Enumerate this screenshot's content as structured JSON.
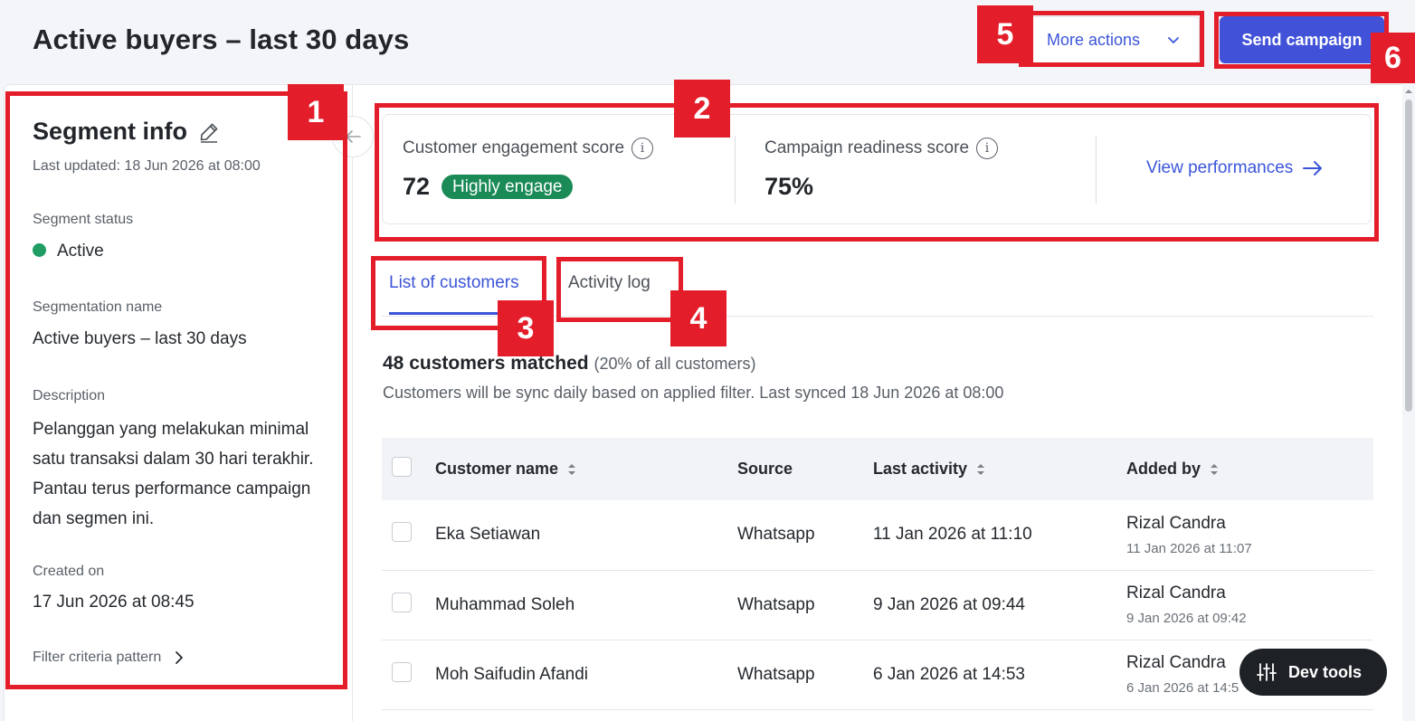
{
  "header": {
    "title": "Active buyers – last 30 days",
    "more_actions": "More actions",
    "send_campaign": "Send campaign"
  },
  "segment_info": {
    "title": "Segment info",
    "last_updated": "Last updated: 18 Jun 2026 at 08:00",
    "status_label": "Segment status",
    "status_value": "Active",
    "name_label": "Segmentation name",
    "name_value": "Active buyers – last 30 days",
    "description_label": "Description",
    "description_value": "Pelanggan yang melakukan minimal satu transaksi dalam 30 hari terakhir. Pantau terus performance campaign dan segmen ini.",
    "created_label": "Created on",
    "created_value": "17 Jun 2026 at 08:45",
    "filter_link": "Filter criteria pattern"
  },
  "scores": {
    "engagement_label": "Customer engagement score",
    "engagement_value": "72",
    "engagement_badge": "Highly engage",
    "readiness_label": "Campaign readiness score",
    "readiness_value": "75%",
    "view_performances": "View performances"
  },
  "tabs": [
    {
      "label": "List of customers",
      "active": true
    },
    {
      "label": "Activity log",
      "active": false
    }
  ],
  "summary": {
    "matched": "48 customers matched",
    "matched_pct": "(20% of all customers)",
    "sync_note": "Customers will be sync daily based on applied filter. Last synced 18 Jun 2026 at 08:00"
  },
  "table": {
    "columns": [
      "Customer name",
      "Source",
      "Last activity",
      "Added by"
    ],
    "rows": [
      {
        "name": "Eka Setiawan",
        "source": "Whatsapp",
        "last_activity": "11 Jan 2026 at 11:10",
        "added_by": "Rizal Candra",
        "added_time": "11 Jan 2026 at 11:07"
      },
      {
        "name": "Muhammad Soleh",
        "source": "Whatsapp",
        "last_activity": "9 Jan 2026 at 09:44",
        "added_by": "Rizal Candra",
        "added_time": "9 Jan 2026 at 09:42"
      },
      {
        "name": "Moh Saifudin Afandi",
        "source": "Whatsapp",
        "last_activity": "6 Jan 2026 at 14:53",
        "added_by": "Rizal Candra",
        "added_time": "6 Jan 2026 at 14:5"
      }
    ]
  },
  "dev_tools": "Dev tools",
  "annotations": [
    "1",
    "2",
    "3",
    "4",
    "5",
    "6"
  ],
  "colors": {
    "accent": "#4152d8",
    "link": "#3b55d9",
    "success": "#1a8a57",
    "annotation": "#e41d2a"
  }
}
